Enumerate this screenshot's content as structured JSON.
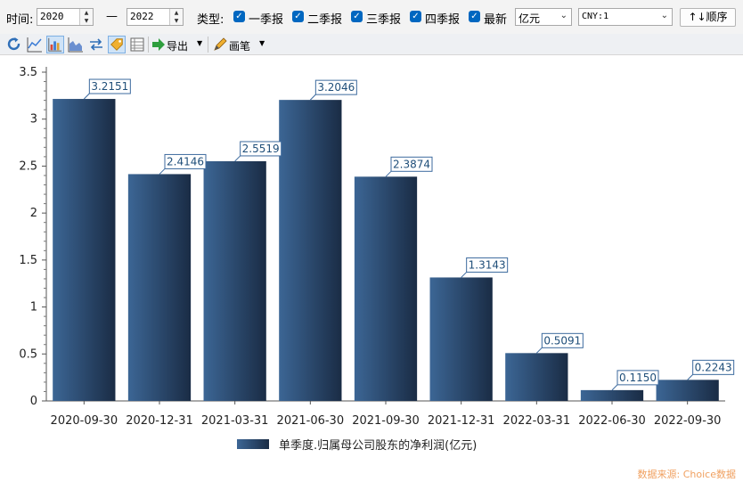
{
  "filters": {
    "time_label": "时间:",
    "start_year": "2020",
    "range_separator": "—",
    "end_year": "2022",
    "type_label": "类型:",
    "checkboxes": [
      {
        "label": "一季报",
        "checked": true
      },
      {
        "label": "二季报",
        "checked": true
      },
      {
        "label": "三季报",
        "checked": true
      },
      {
        "label": "四季报",
        "checked": true
      },
      {
        "label": "最新",
        "checked": true
      }
    ],
    "unit_select": "亿元",
    "currency_select": "CNY:1",
    "sort_button": "↑↓顺序"
  },
  "toolbar": {
    "export_label": "导出",
    "pen_label": "画笔"
  },
  "source": "数据来源: Choice数据",
  "colors": {
    "bar_light": "#3c6695",
    "bar_dark": "#1a2c45",
    "label_border": "#3c6a9e",
    "label_text": "#1f4e79"
  },
  "chart_data": {
    "type": "bar",
    "categories": [
      "2020-09-30",
      "2020-12-31",
      "2021-03-31",
      "2021-06-30",
      "2021-09-30",
      "2021-12-31",
      "2022-03-31",
      "2022-06-30",
      "2022-09-30"
    ],
    "series": [
      {
        "name": "单季度.归属母公司股东的净利润(亿元)",
        "values": [
          3.2151,
          2.4146,
          2.5519,
          3.2046,
          2.3874,
          1.3143,
          0.5091,
          0.115,
          0.2243
        ],
        "labels": [
          "3.2151",
          "2.4146",
          "2.5519",
          "3.2046",
          "2.3874",
          "1.3143",
          "0.5091",
          "0.1150",
          "0.2243"
        ]
      }
    ],
    "yticks": [
      "0",
      "0.5",
      "1",
      "1.5",
      "2",
      "2.5",
      "3",
      "3.5"
    ],
    "ylim": [
      0,
      3.5
    ],
    "legend_position": "bottom"
  }
}
